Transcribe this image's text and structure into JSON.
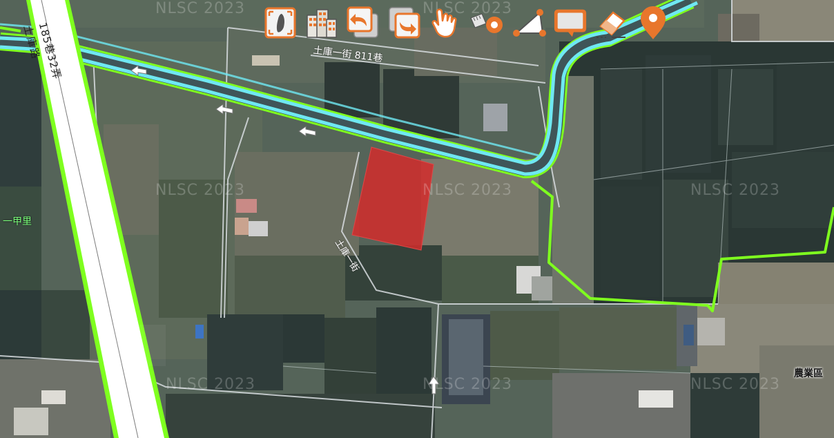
{
  "map": {
    "watermark": "NLSC 2023",
    "roads": {
      "main_road_name": "土庫路",
      "main_road_lane": "185巷32弄",
      "street_name": "土庫一街 811巷",
      "diagonal_road_name": "土庫一街"
    },
    "places": {
      "village_left": "一甲里",
      "farm_area": "農業區"
    }
  },
  "toolbar": {
    "tools": [
      {
        "name": "taiwan-extent-icon"
      },
      {
        "name": "buildings-icon"
      },
      {
        "name": "undo-icon"
      },
      {
        "name": "redo-icon"
      },
      {
        "name": "pan-hand-icon"
      },
      {
        "name": "measure-distance-icon"
      },
      {
        "name": "measure-area-icon"
      },
      {
        "name": "text-box-icon"
      },
      {
        "name": "eraser-icon"
      },
      {
        "name": "location-pin-icon"
      }
    ],
    "accent_color": "#e8762c"
  },
  "colors": {
    "boundary_green": "#7fff1f",
    "river_cyan": "#6fe8f2",
    "highlight_red": "#d42b2b"
  }
}
